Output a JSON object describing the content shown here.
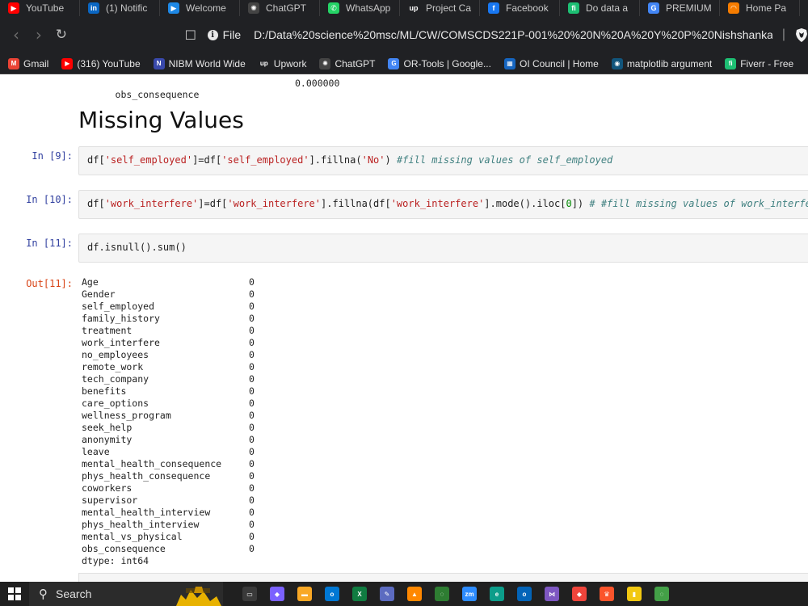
{
  "browser": {
    "tabs": [
      {
        "label": "YouTube",
        "icon": "youtube-icon",
        "color": "#ff0000",
        "glyph": "▶"
      },
      {
        "label": "(1) Notific",
        "icon": "linkedin-icon",
        "color": "#0a66c2",
        "glyph": "in"
      },
      {
        "label": "Welcome",
        "icon": "video-icon",
        "color": "#1e88e5",
        "glyph": "▶"
      },
      {
        "label": "ChatGPT",
        "icon": "openai-icon",
        "color": "#444444",
        "glyph": "✺"
      },
      {
        "label": "WhatsApp",
        "icon": "whatsapp-icon",
        "color": "#25d366",
        "glyph": "✆"
      },
      {
        "label": "Project Ca",
        "icon": "upwork-icon",
        "color": "#202124",
        "glyph": "up"
      },
      {
        "label": "Facebook",
        "icon": "facebook-icon",
        "color": "#1877f2",
        "glyph": "f"
      },
      {
        "label": "Do data a",
        "icon": "fiverr-icon",
        "color": "#1dbf73",
        "glyph": "fi"
      },
      {
        "label": "PREMIUM",
        "icon": "google-icon",
        "color": "#4285f4",
        "glyph": "G"
      },
      {
        "label": "Home Pa",
        "icon": "home-page-icon",
        "color": "#f57c00",
        "glyph": "◠"
      }
    ],
    "nav": {
      "back": "‹",
      "forward": "›",
      "reload": "↻",
      "bookmark": "☐"
    },
    "address": {
      "scheme": "File",
      "url": "D:/Data%20science%20msc/ML/CW/COMSCDS221P-001%20%20N%20A%20Y%20P%20Nishshanka...",
      "separator": "|"
    },
    "bookmarks": [
      {
        "label": "Gmail",
        "icon": "gmail-icon",
        "color": "#ea4335",
        "glyph": "M"
      },
      {
        "label": "(316) YouTube",
        "icon": "youtube-icon",
        "color": "#ff0000",
        "glyph": "▶"
      },
      {
        "label": "NIBM World Wide",
        "icon": "nibm-icon",
        "color": "#3949ab",
        "glyph": "N"
      },
      {
        "label": "Upwork",
        "icon": "upwork-icon",
        "color": "#202124",
        "glyph": "up"
      },
      {
        "label": "ChatGPT",
        "icon": "openai-icon",
        "color": "#444444",
        "glyph": "✺"
      },
      {
        "label": "OR-Tools  |  Google...",
        "icon": "google-icon",
        "color": "#4285f4",
        "glyph": "G"
      },
      {
        "label": "OI Council | Home",
        "icon": "grid-icon",
        "color": "#1565c0",
        "glyph": "▦"
      },
      {
        "label": "matplotlib argument",
        "icon": "matplotlib-icon",
        "color": "#11557c",
        "glyph": "◉"
      },
      {
        "label": "Fiverr - Free",
        "icon": "fiverr-icon",
        "color": "#1dbf73",
        "glyph": "fi"
      }
    ]
  },
  "notebook": {
    "prev_output": {
      "key": "obs_consequence",
      "value": "0.000000"
    },
    "heading": "Missing Values",
    "cells": [
      {
        "prompt": "In [9]:",
        "code": [
          {
            "t": "df[",
            "k": "p"
          },
          {
            "t": "'self_employed'",
            "k": "s"
          },
          {
            "t": "]=df[",
            "k": "p"
          },
          {
            "t": "'self_employed'",
            "k": "s"
          },
          {
            "t": "].fillna(",
            "k": "p"
          },
          {
            "t": "'No'",
            "k": "s"
          },
          {
            "t": ") ",
            "k": "p"
          },
          {
            "t": "#fill missing values of self_employed",
            "k": "c"
          }
        ]
      },
      {
        "prompt": "In [10]:",
        "code": [
          {
            "t": "df[",
            "k": "p"
          },
          {
            "t": "'work_interfere'",
            "k": "s"
          },
          {
            "t": "]=df[",
            "k": "p"
          },
          {
            "t": "'work_interfere'",
            "k": "s"
          },
          {
            "t": "].fillna(df[",
            "k": "p"
          },
          {
            "t": "'work_interfere'",
            "k": "s"
          },
          {
            "t": "].mode().iloc[",
            "k": "p"
          },
          {
            "t": "0",
            "k": "n"
          },
          {
            "t": "]) ",
            "k": "p"
          },
          {
            "t": "# #fill missing values of work_interfere",
            "k": "c"
          }
        ]
      },
      {
        "prompt": "In [11]:",
        "code": [
          {
            "t": "df.isnull().sum()",
            "k": "p"
          }
        ]
      }
    ],
    "output": {
      "prompt": "Out[11]:",
      "rows": [
        {
          "k": "Age",
          "v": "0"
        },
        {
          "k": "Gender",
          "v": "0"
        },
        {
          "k": "self_employed",
          "v": "0"
        },
        {
          "k": "family_history",
          "v": "0"
        },
        {
          "k": "treatment",
          "v": "0"
        },
        {
          "k": "work_interfere",
          "v": "0"
        },
        {
          "k": "no_employees",
          "v": "0"
        },
        {
          "k": "remote_work",
          "v": "0"
        },
        {
          "k": "tech_company",
          "v": "0"
        },
        {
          "k": "benefits",
          "v": "0"
        },
        {
          "k": "care_options",
          "v": "0"
        },
        {
          "k": "wellness_program",
          "v": "0"
        },
        {
          "k": "seek_help",
          "v": "0"
        },
        {
          "k": "anonymity",
          "v": "0"
        },
        {
          "k": "leave",
          "v": "0"
        },
        {
          "k": "mental_health_consequence",
          "v": "0"
        },
        {
          "k": "phys_health_consequence",
          "v": "0"
        },
        {
          "k": "coworkers",
          "v": "0"
        },
        {
          "k": "supervisor",
          "v": "0"
        },
        {
          "k": "mental_health_interview",
          "v": "0"
        },
        {
          "k": "phys_health_interview",
          "v": "0"
        },
        {
          "k": "mental_vs_physical",
          "v": "0"
        },
        {
          "k": "obs_consequence",
          "v": "0"
        },
        {
          "k": "dtype: int64",
          "v": ""
        }
      ]
    }
  },
  "taskbar": {
    "search_label": "Search",
    "apps": [
      {
        "icon": "task-view-icon",
        "color": "#3a3a3a",
        "glyph": "▭"
      },
      {
        "icon": "copilot-icon",
        "color": "#7b61ff",
        "glyph": "◆"
      },
      {
        "icon": "file-explorer-icon",
        "color": "#f9a825",
        "glyph": "▬"
      },
      {
        "icon": "outlook-icon",
        "color": "#0078d4",
        "glyph": "o"
      },
      {
        "icon": "excel-icon",
        "color": "#107c41",
        "glyph": "X"
      },
      {
        "icon": "paint-icon",
        "color": "#5c6bc0",
        "glyph": "✎"
      },
      {
        "icon": "vlc-icon",
        "color": "#ff8800",
        "glyph": "▲"
      },
      {
        "icon": "spinner-app-icon",
        "color": "#2e7d32",
        "glyph": "◌"
      },
      {
        "icon": "zoom-icon",
        "color": "#2d8cff",
        "glyph": "zm"
      },
      {
        "icon": "edge-icon",
        "color": "#0c9d8a",
        "glyph": "e"
      },
      {
        "icon": "outlook-alt-icon",
        "color": "#0364b8",
        "glyph": "o"
      },
      {
        "icon": "visual-studio-icon",
        "color": "#7e57c2",
        "glyph": "⋈"
      },
      {
        "icon": "anydesk-icon",
        "color": "#ef443b",
        "glyph": "◆"
      },
      {
        "icon": "brave-icon",
        "color": "#fb542b",
        "glyph": "♛"
      },
      {
        "icon": "power-bi-icon",
        "color": "#f2c811",
        "glyph": "▮"
      },
      {
        "icon": "status-ring-icon",
        "color": "#43a047",
        "glyph": "◌"
      }
    ]
  }
}
